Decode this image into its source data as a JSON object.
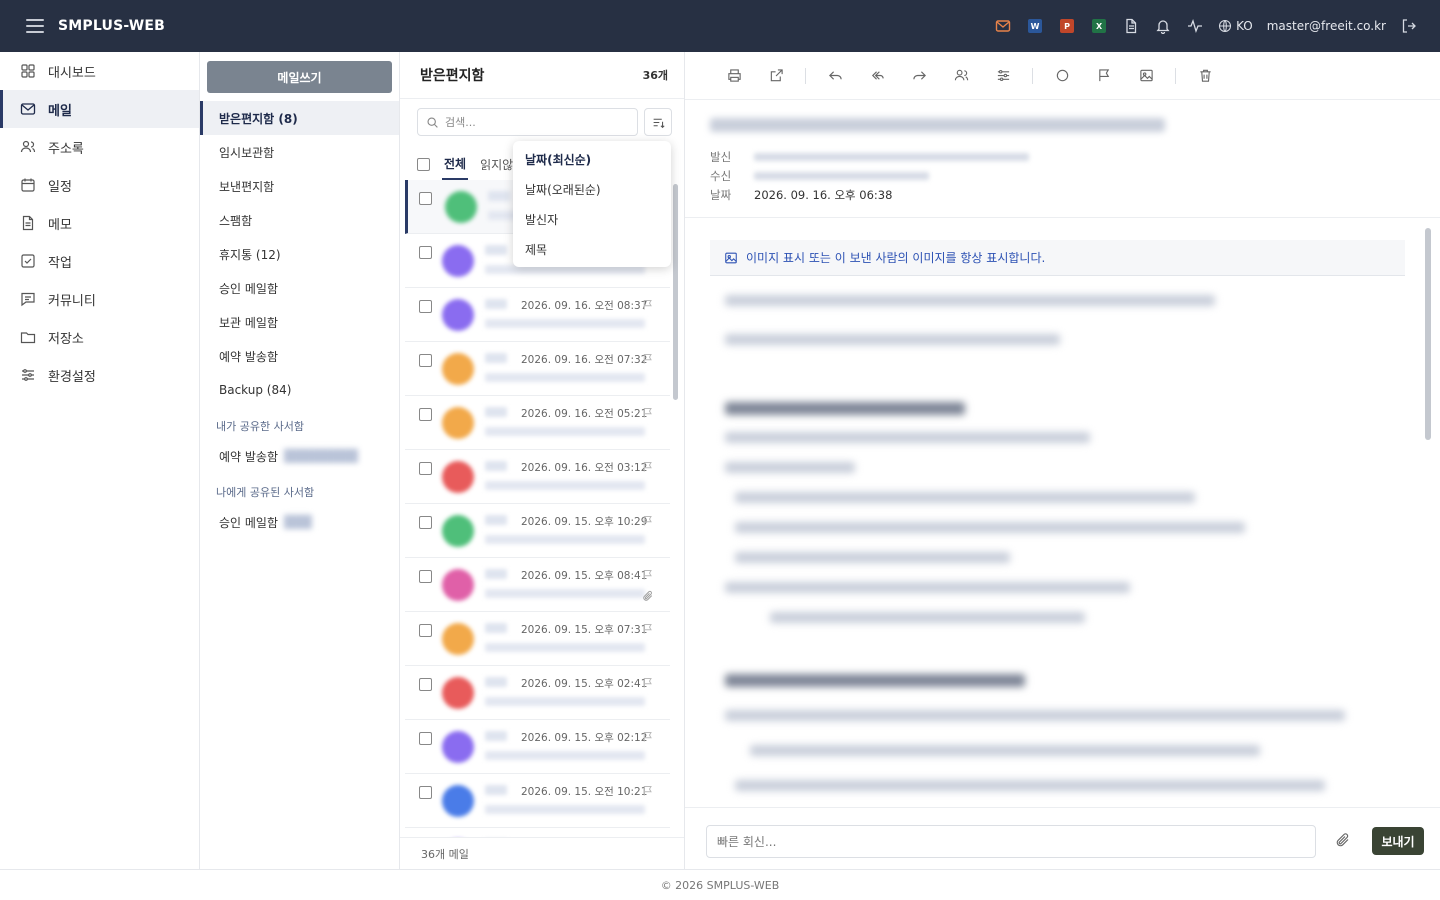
{
  "topbar": {
    "brand": "SMPLUS-WEB",
    "apps": [
      {
        "name": "word",
        "letter": "W",
        "color": "#2b579a"
      },
      {
        "name": "powerpoint",
        "letter": "P",
        "color": "#c0462a"
      },
      {
        "name": "excel",
        "letter": "X",
        "color": "#217346"
      }
    ],
    "mail_icon_color": "#e8834a",
    "lang": "KO",
    "user_email": "master@freeit.co.kr"
  },
  "sidebar": {
    "items": [
      {
        "label": "대시보드",
        "icon": "grid-icon"
      },
      {
        "label": "메일",
        "icon": "mail-icon",
        "active": true
      },
      {
        "label": "주소록",
        "icon": "users-icon"
      },
      {
        "label": "일정",
        "icon": "calendar-icon"
      },
      {
        "label": "메모",
        "icon": "memo-icon"
      },
      {
        "label": "작업",
        "icon": "task-icon"
      },
      {
        "label": "커뮤니티",
        "icon": "chat-icon"
      },
      {
        "label": "저장소",
        "icon": "folder-icon"
      },
      {
        "label": "환경설정",
        "icon": "sliders-icon"
      }
    ]
  },
  "folders": {
    "compose_label": "메일쓰기",
    "items": [
      {
        "label": "받은편지함 (8)"
      },
      {
        "label": "임시보관함"
      },
      {
        "label": "보낸편지함"
      },
      {
        "label": "스팸함"
      },
      {
        "label": "휴지통 (12)"
      },
      {
        "label": "승인 메일함"
      },
      {
        "label": "보관 메일함"
      },
      {
        "label": "예약 발송함"
      },
      {
        "label": "Backup (84)"
      }
    ],
    "shared_by_me_title": "내가 공유한 사서함",
    "shared_by_me_item": "예약 발송함",
    "shared_to_me_title": "나에게 공유된 사서함",
    "shared_to_me_item": "승인 메일함"
  },
  "list": {
    "title": "받은편지함",
    "count": "36개",
    "search_placeholder": "검색...",
    "tabs": [
      "전체",
      "읽지않"
    ],
    "footer": "36개 메일",
    "rows": [
      {
        "date": "",
        "color": "#4fbf7a",
        "selected": true
      },
      {
        "date": "",
        "color": "#8a6cf0"
      },
      {
        "date": "2026. 09. 16. 오전 08:37",
        "color": "#8a6cf0"
      },
      {
        "date": "2026. 09. 16. 오전 07:32",
        "color": "#f2a94a"
      },
      {
        "date": "2026. 09. 16. 오전 05:21",
        "color": "#f2a94a"
      },
      {
        "date": "2026. 09. 16. 오전 03:12",
        "color": "#e85b5b"
      },
      {
        "date": "2026. 09. 15. 오후 10:29",
        "color": "#4fbf7a"
      },
      {
        "date": "2026. 09. 15. 오후 08:41",
        "color": "#e060a8",
        "attachment": true
      },
      {
        "date": "2026. 09. 15. 오후 07:31",
        "color": "#f2a94a"
      },
      {
        "date": "2026. 09. 15. 오후 02:41",
        "color": "#e85b5b"
      },
      {
        "date": "2026. 09. 15. 오후 02:12",
        "color": "#8a6cf0"
      },
      {
        "date": "2026. 09. 15. 오전 10:21",
        "color": "#4a7ce8"
      },
      {
        "date": "",
        "color": "#8a6cf0"
      }
    ]
  },
  "sort_menu": {
    "options": [
      "날짜(최신순)",
      "날짜(오래된순)",
      "발신자",
      "제목"
    ]
  },
  "reader": {
    "from_label": "발신",
    "to_label": "수신",
    "date_label": "날짜",
    "date_value": "2026. 09. 16. 오후 06:38",
    "image_notice": "이미지 표시 또는 이 보낸 사람의 이미지를 항상 표시합니다.",
    "reply_placeholder": "빠른 회신...",
    "send_label": "보내기"
  },
  "footer": {
    "text": "© 2026 SMPLUS-WEB"
  }
}
